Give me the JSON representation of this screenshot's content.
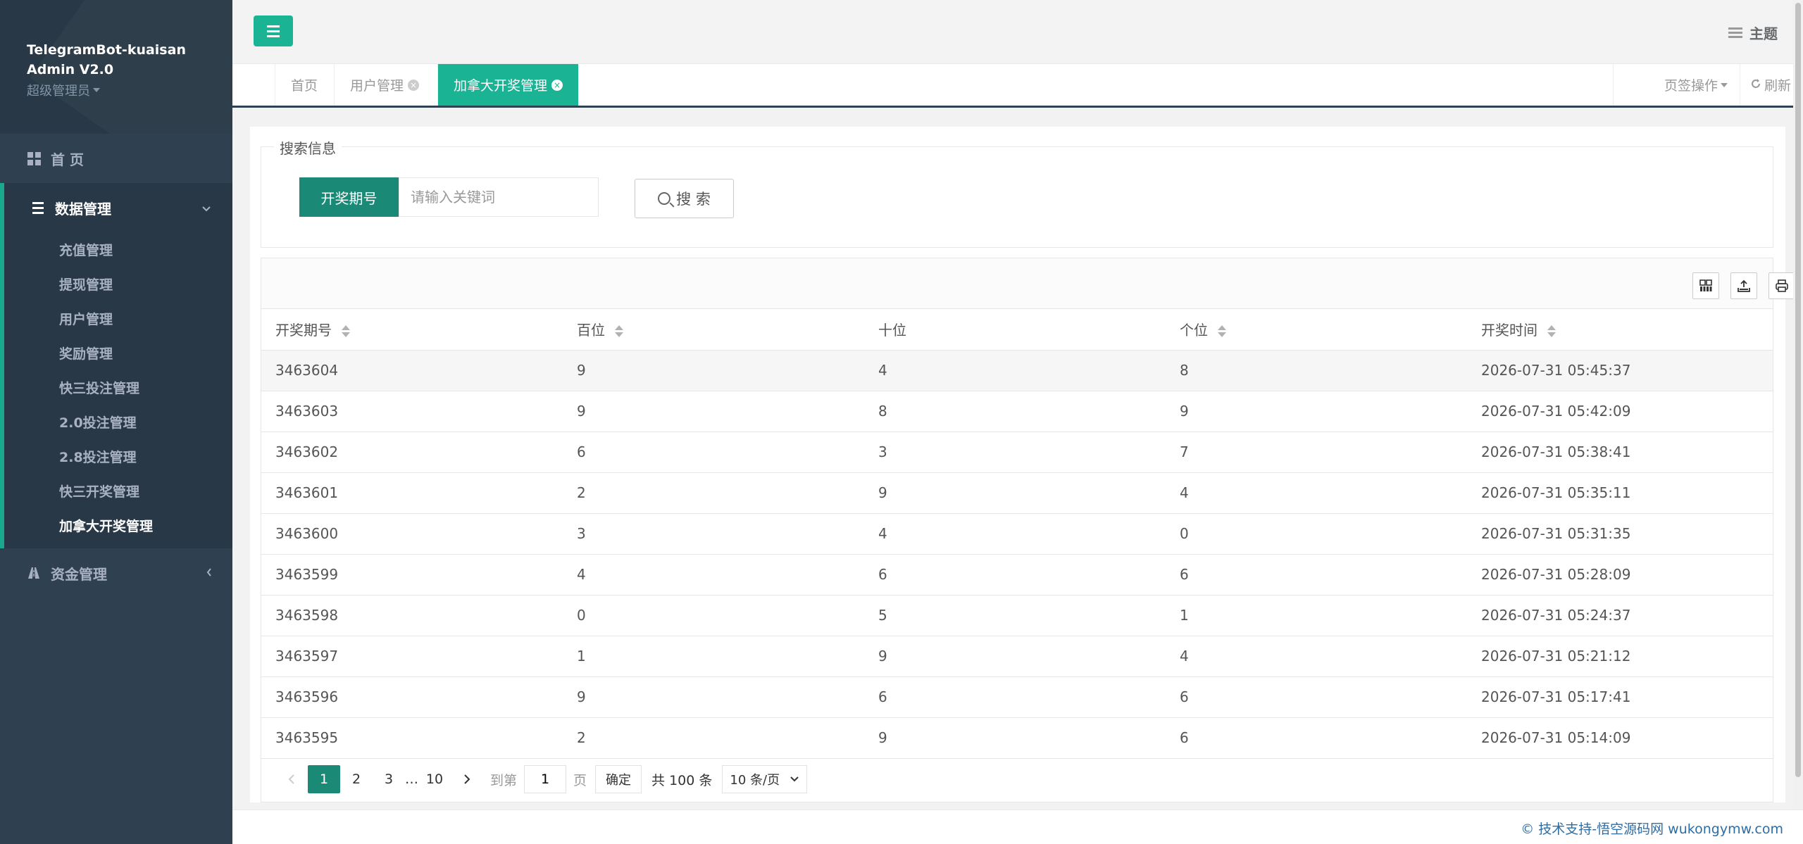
{
  "brand": {
    "title_line1": "TelegramBot-kuaisan",
    "title_line2": "Admin V2.0",
    "role": "超级管理员"
  },
  "sidebar": {
    "home_label": "首 页",
    "data_group": {
      "label": "数据管理",
      "items": [
        {
          "label": "充值管理"
        },
        {
          "label": "提现管理"
        },
        {
          "label": "用户管理"
        },
        {
          "label": "奖励管理"
        },
        {
          "label": "快三投注管理"
        },
        {
          "label": "2.0投注管理"
        },
        {
          "label": "2.8投注管理"
        },
        {
          "label": "快三开奖管理"
        },
        {
          "label": "加拿大开奖管理"
        }
      ]
    },
    "money_label": "资金管理"
  },
  "header": {
    "theme_label": "主题"
  },
  "tabs": {
    "items": [
      {
        "label": "首页"
      },
      {
        "label": "用户管理"
      },
      {
        "label": "加拿大开奖管理"
      }
    ],
    "tab_ops_label": "页签操作",
    "refresh_label": "刷新"
  },
  "search": {
    "legend": "搜索信息",
    "field_label": "开奖期号",
    "placeholder": "请输入关键词",
    "button_label": "搜 索"
  },
  "table": {
    "headers": [
      "开奖期号",
      "百位",
      "十位",
      "个位",
      "开奖时间"
    ],
    "rows": [
      [
        "3463604",
        "9",
        "4",
        "8",
        "2026-07-31 05:45:37"
      ],
      [
        "3463603",
        "9",
        "8",
        "9",
        "2026-07-31 05:42:09"
      ],
      [
        "3463602",
        "6",
        "3",
        "7",
        "2026-07-31 05:38:41"
      ],
      [
        "3463601",
        "2",
        "9",
        "4",
        "2026-07-31 05:35:11"
      ],
      [
        "3463600",
        "3",
        "4",
        "0",
        "2026-07-31 05:31:35"
      ],
      [
        "3463599",
        "4",
        "6",
        "6",
        "2026-07-31 05:28:09"
      ],
      [
        "3463598",
        "0",
        "5",
        "1",
        "2026-07-31 05:24:37"
      ],
      [
        "3463597",
        "1",
        "9",
        "4",
        "2026-07-31 05:21:12"
      ],
      [
        "3463596",
        "9",
        "6",
        "6",
        "2026-07-31 05:17:41"
      ],
      [
        "3463595",
        "2",
        "9",
        "6",
        "2026-07-31 05:14:09"
      ]
    ]
  },
  "pagination": {
    "pages": [
      "1",
      "2",
      "3"
    ],
    "ellipsis": "…",
    "last_page": "10",
    "goto_label": "到第",
    "goto_value": "1",
    "page_unit": "页",
    "confirm_label": "确定",
    "total_text": "共 100 条",
    "page_size": "10 条/页"
  },
  "footer": {
    "text": "© 技术支持-悟空源码网 wukongymw.com"
  },
  "colors": {
    "accent": "#1ab394",
    "sidebar_bg": "#2f4050"
  }
}
